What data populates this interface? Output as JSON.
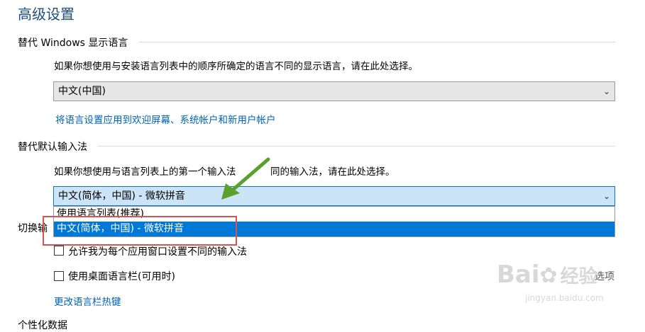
{
  "page": {
    "title": "高级设置"
  },
  "display_language": {
    "header": "替代 Windows 显示语言",
    "description": "如果你想使用与安装语言列表中的顺序所确定的语言不同的显示语言，请在此处选择。",
    "selected": "中文(中国)",
    "link": "将语言设置应用到欢迎屏幕、系统帐户和新用户帐户"
  },
  "input_method": {
    "header": "替代默认输入法",
    "description_left": "如果你想使用与语言列表上的第一个输入法",
    "description_right": "同的输入法，请在此处选择。",
    "selected": "中文(简体，中国) - 微软拼音",
    "options": [
      {
        "label": "使用语言列表(推荐)"
      },
      {
        "label": "中文(简体，中国) - 微软拼音"
      }
    ]
  },
  "switch_input": {
    "header_partial": "切换输",
    "checkbox1_label": "允许我为每个应用窗口设置不同的输入法",
    "checkbox2_label": "使用桌面语言栏(可用时)",
    "options_label": "选项",
    "link": "更改语言栏热键"
  },
  "bottom_partial": "个性化数据",
  "watermark": {
    "brand": "Bai",
    "cn": "经验",
    "url": "jingyan.baidu.com"
  },
  "colors": {
    "accent": "#0078d7",
    "link": "#0063b1",
    "annotation_box": "#d9534f",
    "annotation_arrow": "#5aa02c"
  }
}
